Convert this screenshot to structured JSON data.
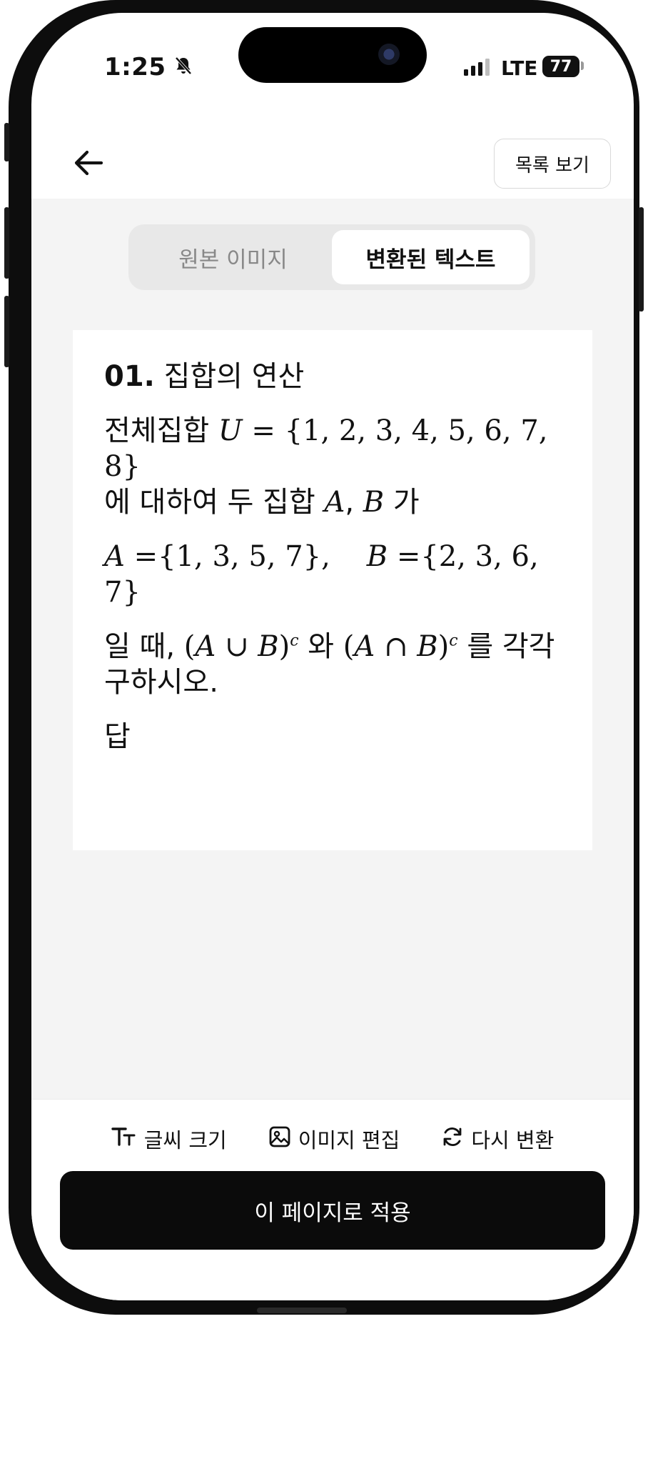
{
  "status_bar": {
    "time": "1:25",
    "network": "LTE",
    "battery": "77",
    "icons": [
      "bell-muted-icon",
      "signal-icon"
    ]
  },
  "nav": {
    "back_icon": "arrow-left-icon",
    "list_button": "목록 보기"
  },
  "tabs": [
    {
      "label": "원본 이미지",
      "active": false
    },
    {
      "label": "변환된 텍스트",
      "active": true
    }
  ],
  "problem": {
    "number": "01.",
    "title": "집합의 연산",
    "line1_text": "전체집합",
    "universe_var": "U",
    "universe_set": "= {1, 2, 3, 4, 5, 6, 7, 8}",
    "line2_text": "에 대하여 두 집합",
    "set_a": "A",
    "comma": ",",
    "set_b": "B",
    "line2_end": "가",
    "a_set_value": "={1, 3, 5, 7},",
    "b_set_value": "={2, 3, 6, 7}",
    "line4_start": "일 때,",
    "union_expr_open": "(",
    "union_expr_a": "A",
    "union_op": " ∪ ",
    "union_expr_b": "B",
    "union_expr_close": ")",
    "complement": "c",
    "connector": "와",
    "intersection_op": " ∩ ",
    "line4_end": "를 각각",
    "line5": "구하시오.",
    "answer_label": "답"
  },
  "tools": [
    {
      "label": "글씨 크기",
      "icon": "font-size-icon"
    },
    {
      "label": "이미지 편집",
      "icon": "image-edit-icon"
    },
    {
      "label": "다시 변환",
      "icon": "refresh-icon"
    }
  ],
  "apply_button": "이 페이지로 적용"
}
